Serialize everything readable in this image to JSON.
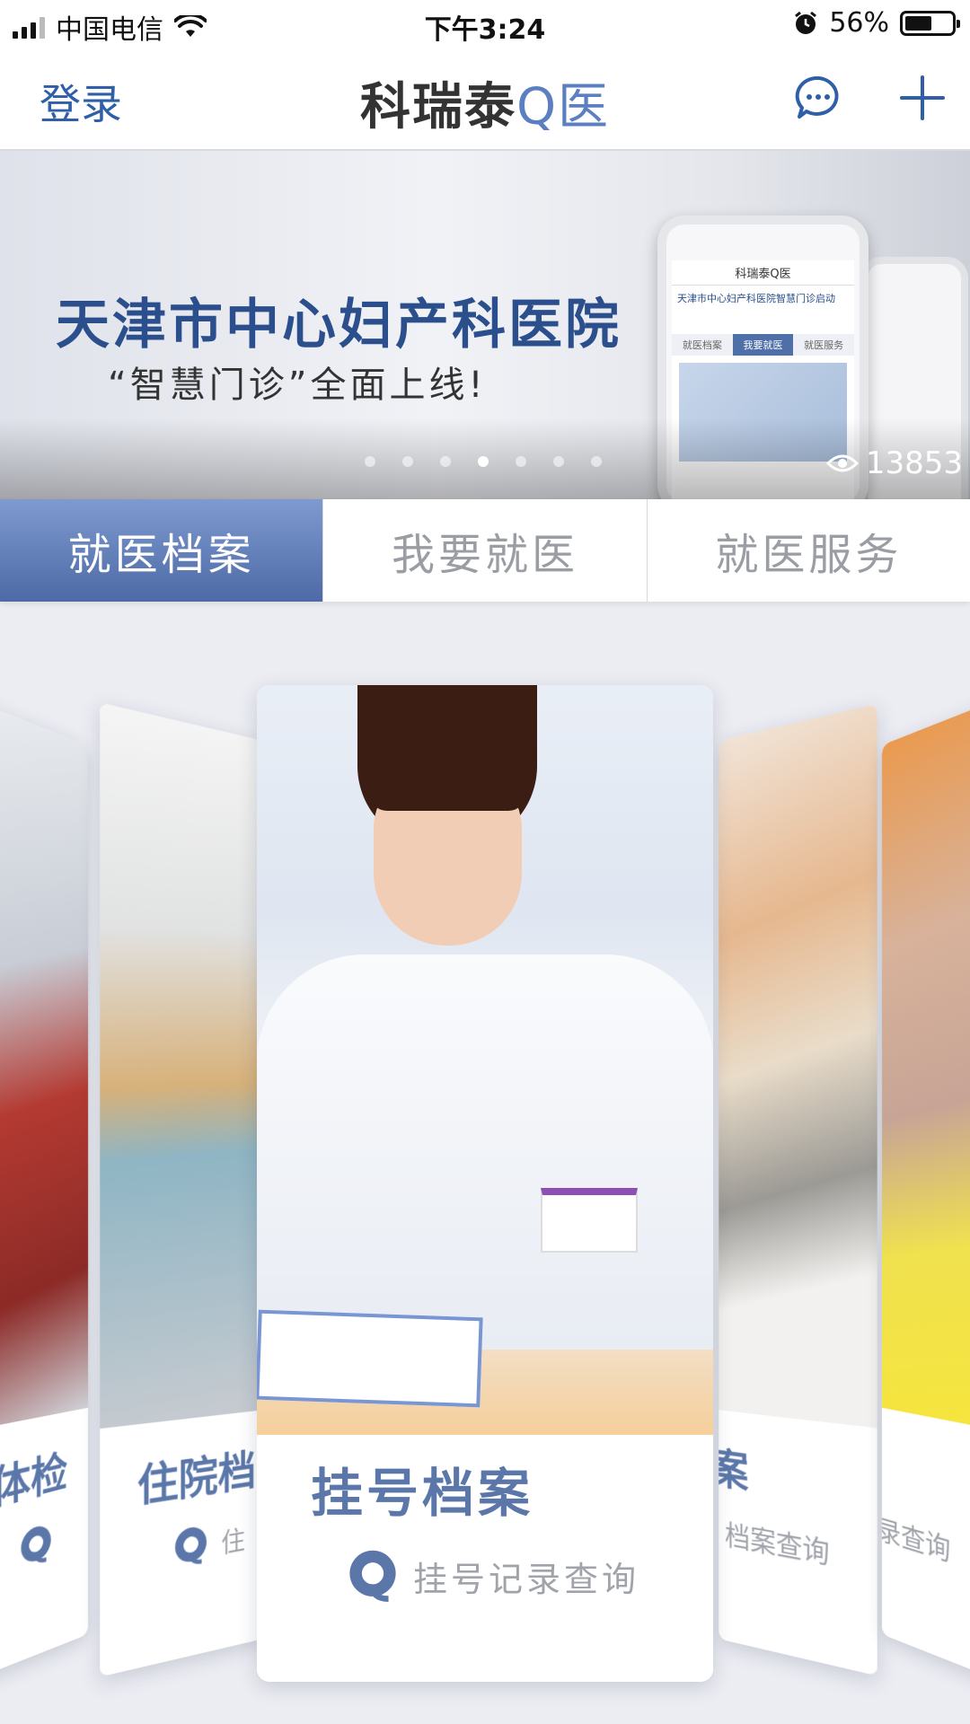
{
  "status_bar": {
    "carrier": "中国电信",
    "time": "下午3:24",
    "battery": "56%",
    "battery_level": 0.56,
    "icons": [
      "signal-icon",
      "wifi-icon",
      "alarm-icon",
      "battery-icon"
    ]
  },
  "nav": {
    "login": "登录",
    "logo_main": "科瑞泰",
    "logo_accent": "Q医",
    "icons": [
      "chat-icon",
      "plus-icon"
    ]
  },
  "banner": {
    "title": "天津市中心妇产科医院",
    "subtitle": "“智慧门诊”全面上线!",
    "views": "13853",
    "page_count": 7,
    "active_page": 4,
    "phone_screen": {
      "app_title": "科瑞泰Q医",
      "headline": "天津市中心妇产科医院智慧门诊启动",
      "tabs": [
        "就医档案",
        "我要就医",
        "就医服务"
      ]
    }
  },
  "tabs": {
    "items": [
      "就医档案",
      "我要就医",
      "就医服务"
    ],
    "active": 0
  },
  "cards": {
    "far_left": {
      "title": "体检",
      "subtitle": ""
    },
    "left": {
      "title": "住院档",
      "subtitle": "住"
    },
    "center": {
      "title": "挂号档案",
      "subtitle": "挂号记录查询"
    },
    "right": {
      "title": "案",
      "subtitle": "档案查询"
    },
    "far_right": {
      "title": "",
      "subtitle": "录查询"
    }
  },
  "colors": {
    "accent": "#4d6aa6",
    "link": "#2e5fa8",
    "card_title": "#5b77a9",
    "muted_text": "#a0a3aa"
  }
}
